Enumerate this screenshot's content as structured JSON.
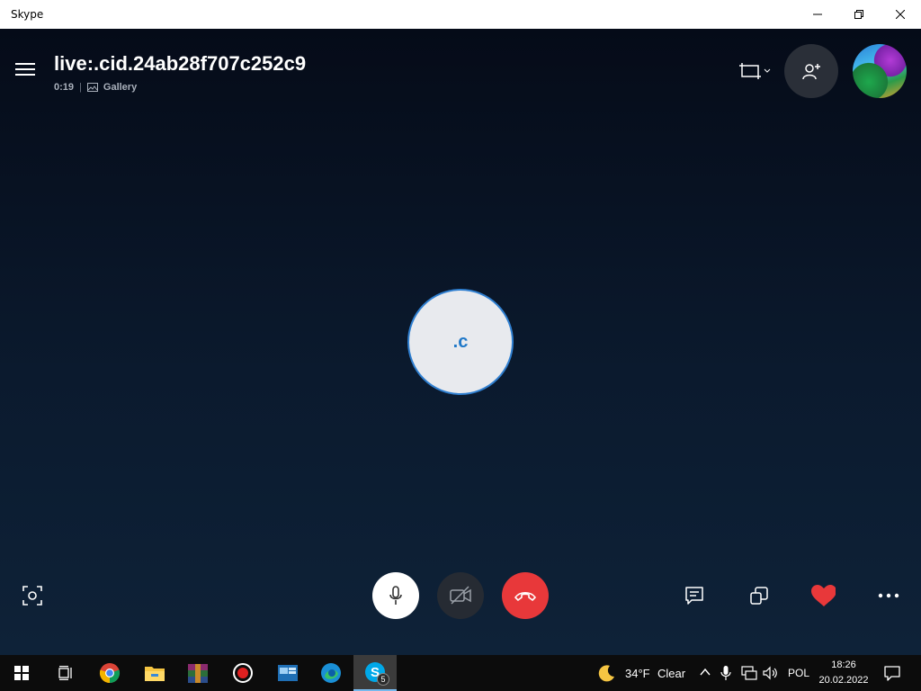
{
  "window": {
    "title": "Skype"
  },
  "call": {
    "title": "live:.cid.24ab28f707c252c9",
    "duration": "0:19",
    "separator": "|",
    "view_mode": "Gallery",
    "participant_initials": ".c"
  },
  "colors": {
    "hangup": "#e8383a",
    "accent": "#1f78c8",
    "background": "#071020"
  },
  "icons": {
    "menu": "hamburger-icon",
    "layout": "layout-icon",
    "add_person": "add-person-icon",
    "mic": "microphone-icon",
    "video": "video-off-icon",
    "hangup": "hangup-icon",
    "snapshot": "camera-snapshot-icon",
    "chat": "chat-icon",
    "share": "share-screen-icon",
    "react": "heart-icon",
    "more": "more-icon"
  },
  "taskbar": {
    "skype_badge": "5",
    "weather_temp": "34°F",
    "weather_text": "Clear",
    "language": "POL",
    "time": "18:26",
    "date": "20.02.2022"
  }
}
